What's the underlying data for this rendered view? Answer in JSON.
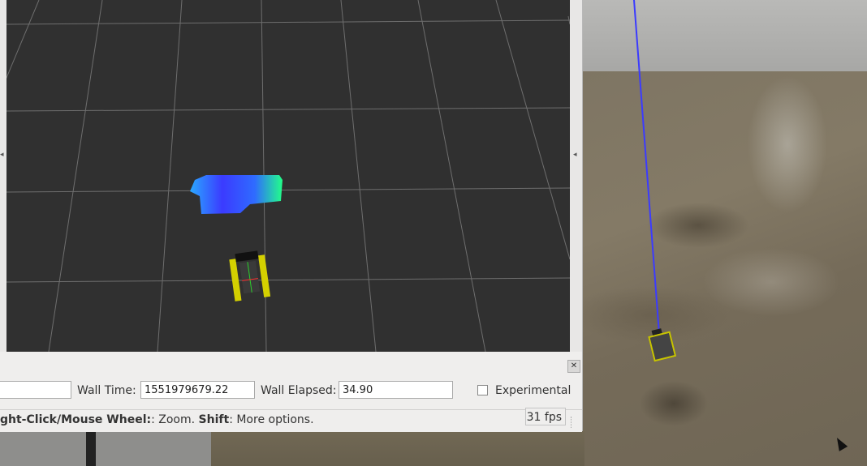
{
  "time_panel": {
    "wall_time_label": "Wall Time:",
    "wall_time_value": "1551979679.22",
    "wall_elapsed_label": "Wall Elapsed:",
    "wall_elapsed_value": "34.90",
    "experimental_label": "Experimental",
    "experimental_checked": false,
    "close_icon": "close-icon"
  },
  "status_bar": {
    "prefix_bold": "ght-Click/Mouse Wheel:",
    "prefix_rest": ": Zoom. ",
    "shift_bold": "Shift",
    "shift_rest": ": More options.",
    "fps": "31 fps"
  },
  "colors": {
    "render_background": "#303030",
    "grid_line": "#6e6e6e",
    "robot_yellow": "#d4d000",
    "axis_blue": "#3b3bff"
  }
}
